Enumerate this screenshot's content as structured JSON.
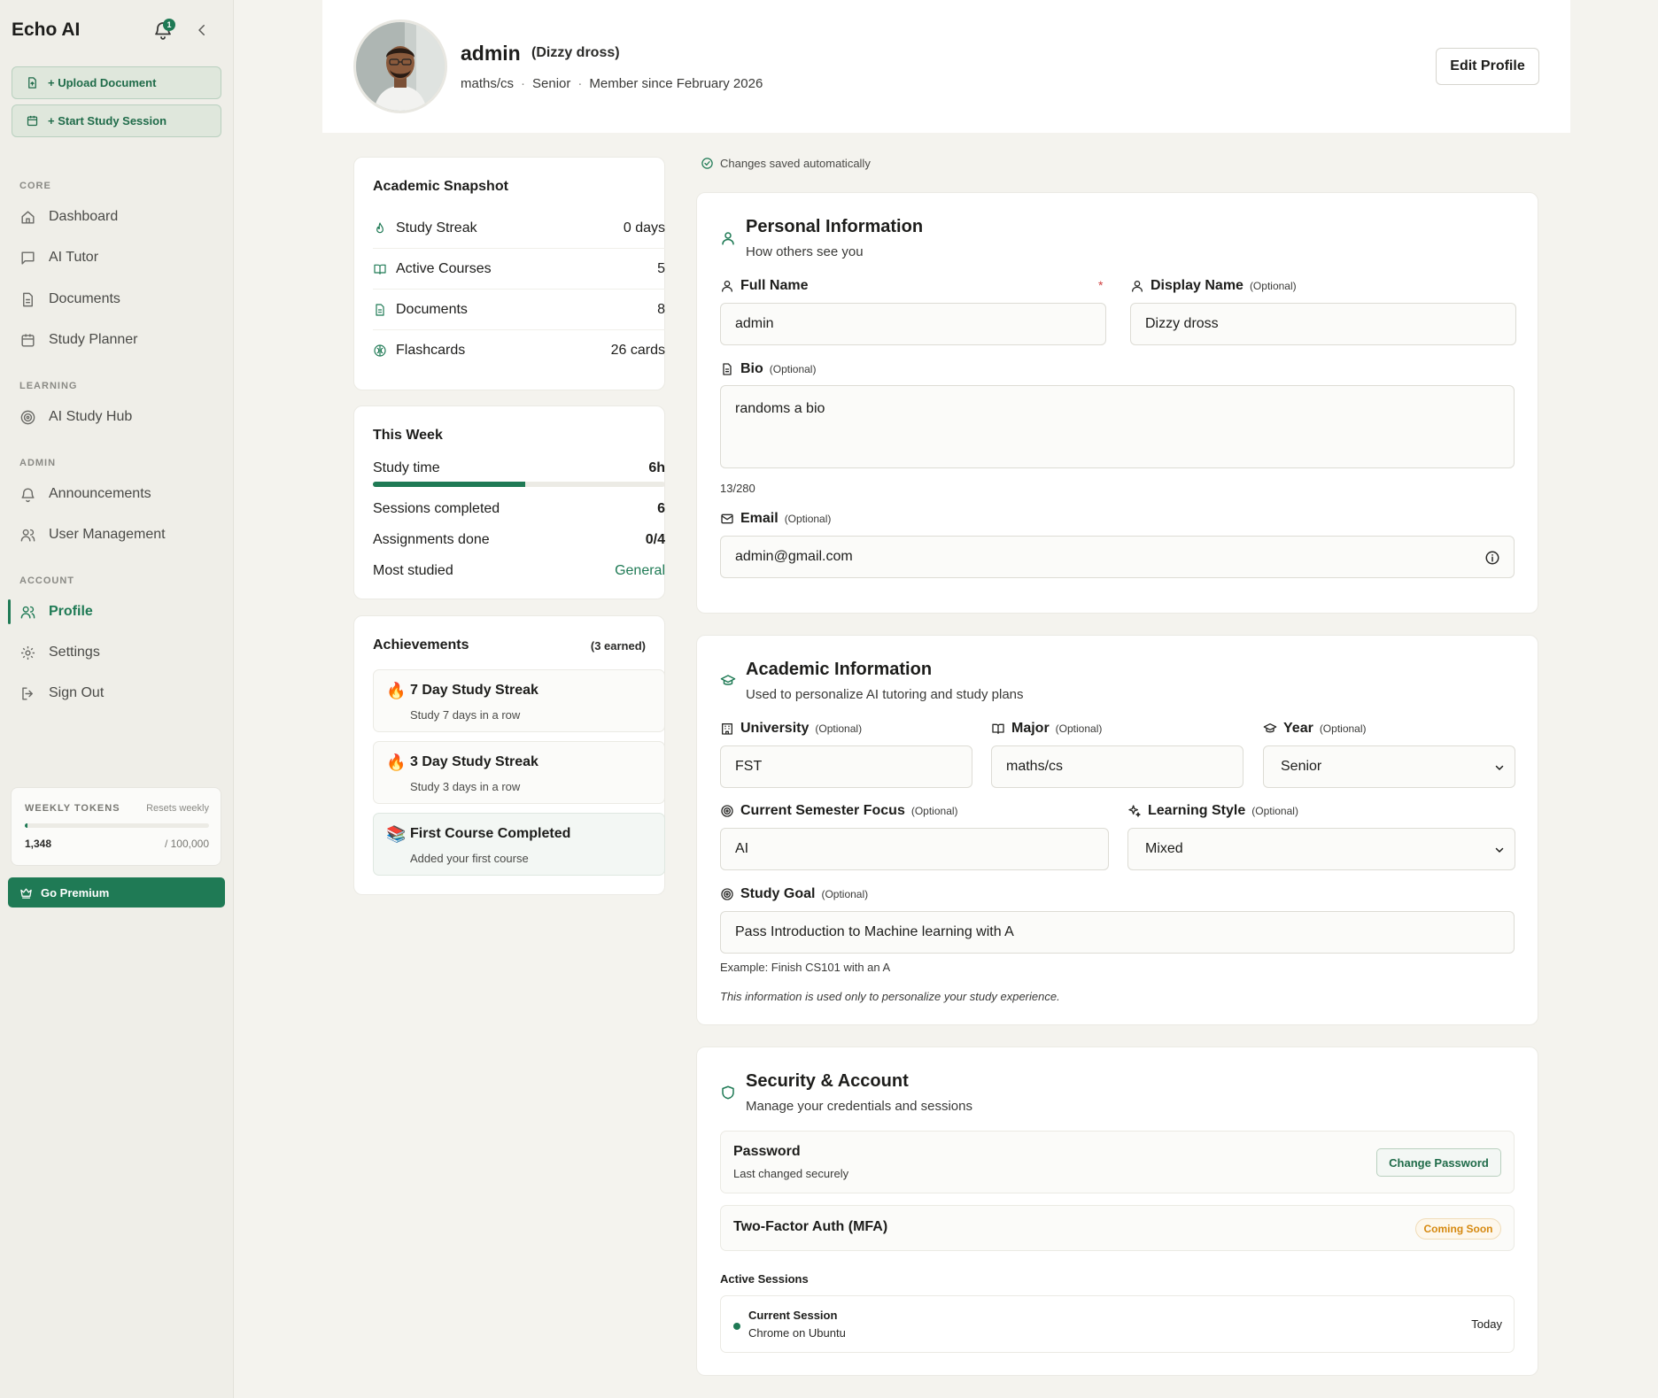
{
  "app": {
    "brand": "Echo AI",
    "notification_count": "1"
  },
  "sidebar": {
    "upload_label": "+ Upload Document",
    "study_session_label": "+ Start Study Session",
    "sections": {
      "core": "CORE",
      "learning": "LEARNING",
      "admin": "ADMIN",
      "account": "ACCOUNT"
    },
    "items": {
      "dashboard": "Dashboard",
      "ai_tutor": "AI Tutor",
      "documents": "Documents",
      "study_planner": "Study Planner",
      "ai_study_hub": "AI Study Hub",
      "announcements": "Announcements",
      "user_management": "User Management",
      "profile": "Profile",
      "settings": "Settings",
      "sign_out": "Sign Out"
    },
    "active_item": "Profile",
    "tokens": {
      "label": "WEEKLY TOKENS",
      "reset": "Resets weekly",
      "used": "1,348",
      "total": "/ 100,000",
      "used_fraction": 0.01348
    },
    "premium_label": "Go Premium"
  },
  "header": {
    "name": "admin",
    "display_name": "(Dizzy dross)",
    "major": "maths/cs",
    "sep": "·",
    "year": "Senior",
    "member_since": "Member since February 2026",
    "edit_label": "Edit Profile"
  },
  "snapshot": {
    "title": "Academic Snapshot",
    "rows": [
      {
        "label": "Study Streak",
        "value": "0 days"
      },
      {
        "label": "Active Courses",
        "value": "5"
      },
      {
        "label": "Documents",
        "value": "8"
      },
      {
        "label": "Flashcards",
        "value": "26 cards"
      }
    ]
  },
  "week": {
    "title": "This Week",
    "study_time_label": "Study time",
    "study_time_value": "6h",
    "study_time_fraction": 0.52,
    "sessions_label": "Sessions completed",
    "sessions_value": "6",
    "assignments_label": "Assignments done",
    "assignments_value": "0/4",
    "most_studied_label": "Most studied",
    "most_studied_value": "General"
  },
  "achievements": {
    "title": "Achievements",
    "count": "(3 earned)",
    "items": [
      {
        "emoji": "🔥",
        "title": "7 Day Study Streak",
        "sub": "Study 7 days in a row"
      },
      {
        "emoji": "🔥",
        "title": "3 Day Study Streak",
        "sub": "Study 3 days in a row"
      },
      {
        "emoji": "📚",
        "title": "First Course Completed",
        "sub": "Added your first course"
      }
    ]
  },
  "saved_notice": "Changes saved automatically",
  "personal": {
    "title": "Personal Information",
    "subtitle": "How others see you",
    "full_name_label": "Full Name",
    "required_mark": "*",
    "full_name_value": "admin",
    "display_name_label": "Display Name",
    "display_name_value": "Dizzy dross",
    "bio_label": "Bio",
    "bio_value": "randoms a bio",
    "bio_count": "13/280",
    "email_label": "Email",
    "email_value": "admin@gmail.com",
    "optional": "(Optional)"
  },
  "academic": {
    "title": "Academic Information",
    "subtitle": "Used to personalize AI tutoring and study plans",
    "university_label": "University",
    "university_value": "FST",
    "major_label": "Major",
    "major_value": "maths/cs",
    "year_label": "Year",
    "year_value": "Senior",
    "focus_label": "Current Semester Focus",
    "focus_value": "AI",
    "style_label": "Learning Style",
    "style_value": "Mixed",
    "goal_label": "Study Goal",
    "goal_value": "Pass Introduction to Machine learning with A",
    "goal_hint": "Example: Finish CS101 with an A",
    "privacy_note": "This information is used only to personalize your study experience."
  },
  "security": {
    "title": "Security & Account",
    "subtitle": "Manage your credentials and sessions",
    "password_label": "Password",
    "password_sub": "Last changed securely",
    "change_password_label": "Change Password",
    "mfa_label": "Two-Factor Auth (MFA)",
    "mfa_badge": "Coming Soon",
    "active_sessions_label": "Active Sessions",
    "session_name": "Current Session",
    "session_device": "Chrome on Ubuntu",
    "session_when": "Today"
  },
  "colors": {
    "accent": "#1f7a55",
    "warning": "#d68910",
    "danger": "#d04040"
  }
}
